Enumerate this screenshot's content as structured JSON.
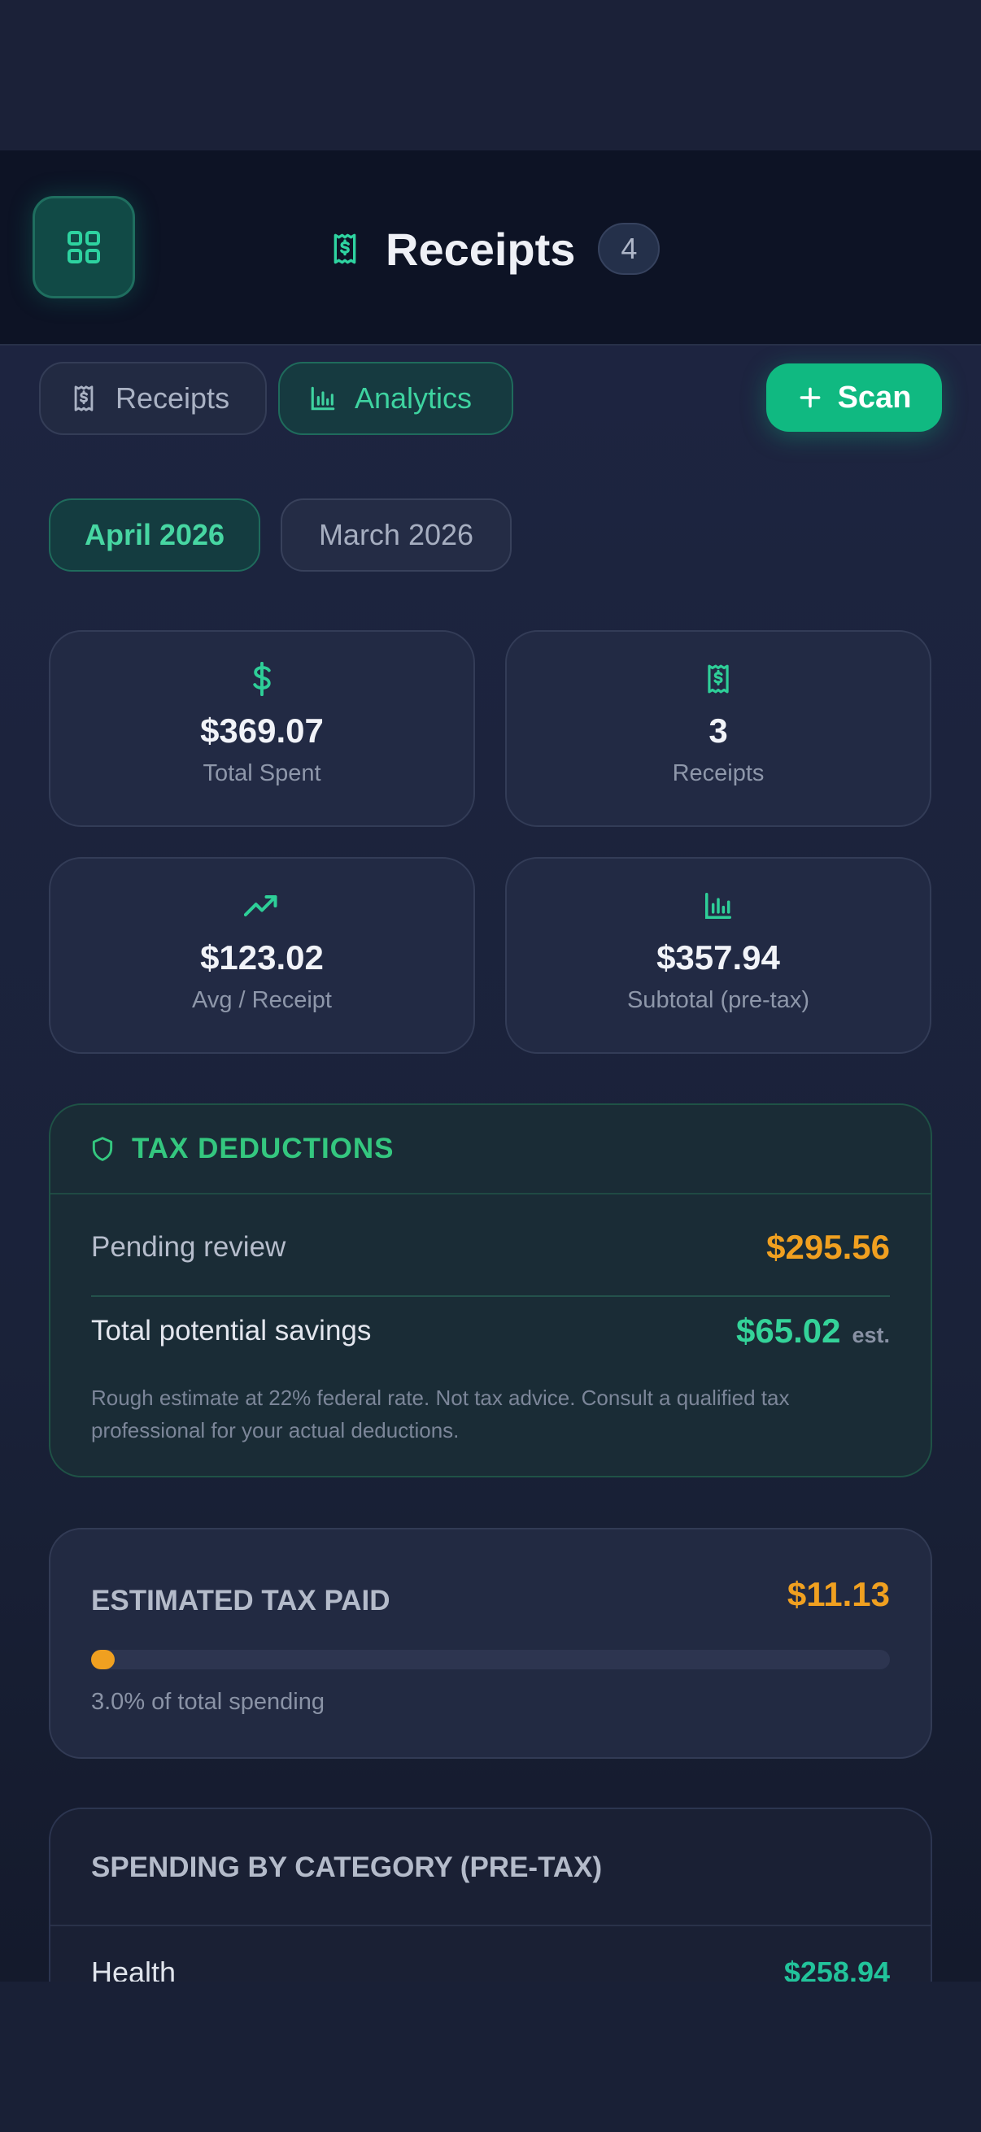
{
  "header": {
    "title": "Receipts",
    "count": "4"
  },
  "tabs": [
    {
      "label": "Receipts",
      "icon": "receipt-icon",
      "active": false
    },
    {
      "label": "Analytics",
      "icon": "bar-chart-icon",
      "active": true
    }
  ],
  "scan_button": {
    "label": "Scan",
    "icon": "plus-icon"
  },
  "months": [
    {
      "label": "April 2026",
      "active": true
    },
    {
      "label": "March 2026",
      "active": false
    }
  ],
  "stats": [
    {
      "value": "$369.07",
      "label": "Total Spent",
      "icon": "dollar-icon"
    },
    {
      "value": "3",
      "label": "Receipts",
      "icon": "receipt-icon"
    },
    {
      "value": "$123.02",
      "label": "Avg / Receipt",
      "icon": "trending-up-icon"
    },
    {
      "value": "$357.94",
      "label": "Subtotal (pre-tax)",
      "icon": "bar-chart-icon"
    }
  ],
  "tax_deductions": {
    "title": "TAX DEDUCTIONS",
    "icon": "shield-icon",
    "pending_label": "Pending review",
    "pending_value": "$295.56",
    "total_label": "Total potential savings",
    "total_value": "$65.02",
    "total_suffix": "est.",
    "note": "Rough estimate at 22% federal rate. Not tax advice. Consult a qualified tax professional for your actual deductions."
  },
  "estimated_tax": {
    "title": "ESTIMATED TAX PAID",
    "value": "$11.13",
    "percent": 3.0,
    "subtitle": "3.0% of total spending"
  },
  "categories": {
    "title": "SPENDING BY CATEGORY (PRE-TAX)",
    "items": [
      {
        "name": "Health",
        "amount": "$258.94"
      }
    ]
  },
  "colors": {
    "accent": "#10b981",
    "accent_text": "#34d399",
    "warning": "#f0a020",
    "background": "#1a2035"
  }
}
